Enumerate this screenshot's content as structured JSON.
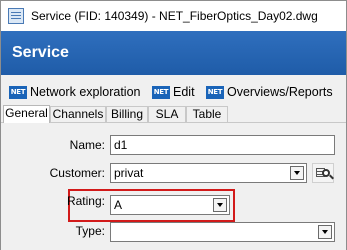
{
  "window": {
    "title": "Service (FID: 140349) - NET_FiberOptics_Day02.dwg"
  },
  "banner": {
    "title": "Service"
  },
  "toolbar": {
    "items": [
      {
        "icon": "net-icon",
        "icon_text": "NET",
        "label": "Network exploration"
      },
      {
        "icon": "net-icon",
        "icon_text": "NET",
        "label": "Edit"
      },
      {
        "icon": "net-icon",
        "icon_text": "NET",
        "label": "Overviews/Reports"
      }
    ]
  },
  "tabs": [
    {
      "label": "General",
      "active": true
    },
    {
      "label": "Channels",
      "active": false
    },
    {
      "label": "Billing",
      "active": false
    },
    {
      "label": "SLA",
      "active": false
    },
    {
      "label": "Table",
      "active": false
    }
  ],
  "form": {
    "name": {
      "label": "Name:",
      "value": "d1"
    },
    "customer": {
      "label": "Customer:",
      "value": "privat"
    },
    "rating": {
      "label": "Rating:",
      "value": "A"
    },
    "type": {
      "label": "Type:",
      "value": ""
    }
  },
  "colors": {
    "banner": "#1f5ca8",
    "highlight": "#d21a1a",
    "net_icon": "#1a64b8"
  }
}
